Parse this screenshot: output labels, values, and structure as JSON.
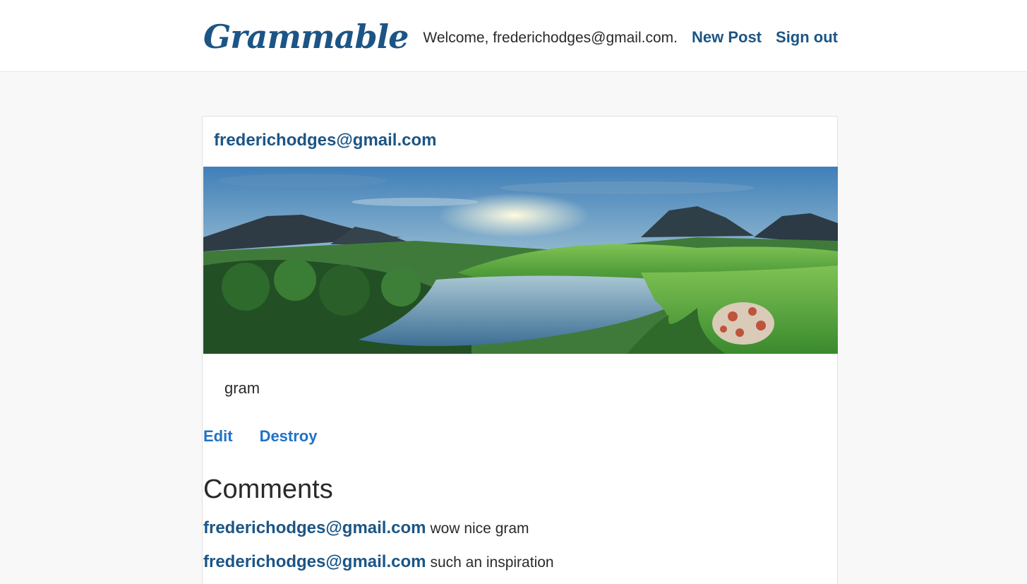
{
  "header": {
    "brand": "Grammable",
    "welcome": "Welcome, frederichodges@gmail.com.",
    "new_post": "New Post",
    "sign_out": "Sign out"
  },
  "post": {
    "author": "frederichodges@gmail.com",
    "image_alt": "landscape with river, hills, sunrise and spotted egg",
    "caption": "gram",
    "edit_label": "Edit",
    "destroy_label": "Destroy"
  },
  "comments": {
    "heading": "Comments",
    "items": [
      {
        "author": "frederichodges@gmail.com",
        "text": "wow nice gram"
      },
      {
        "author": "frederichodges@gmail.com",
        "text": "such an inspiration"
      }
    ]
  },
  "colors": {
    "brand": "#1c5585",
    "action_link": "#1f72c8",
    "background": "#f8f8f8"
  }
}
